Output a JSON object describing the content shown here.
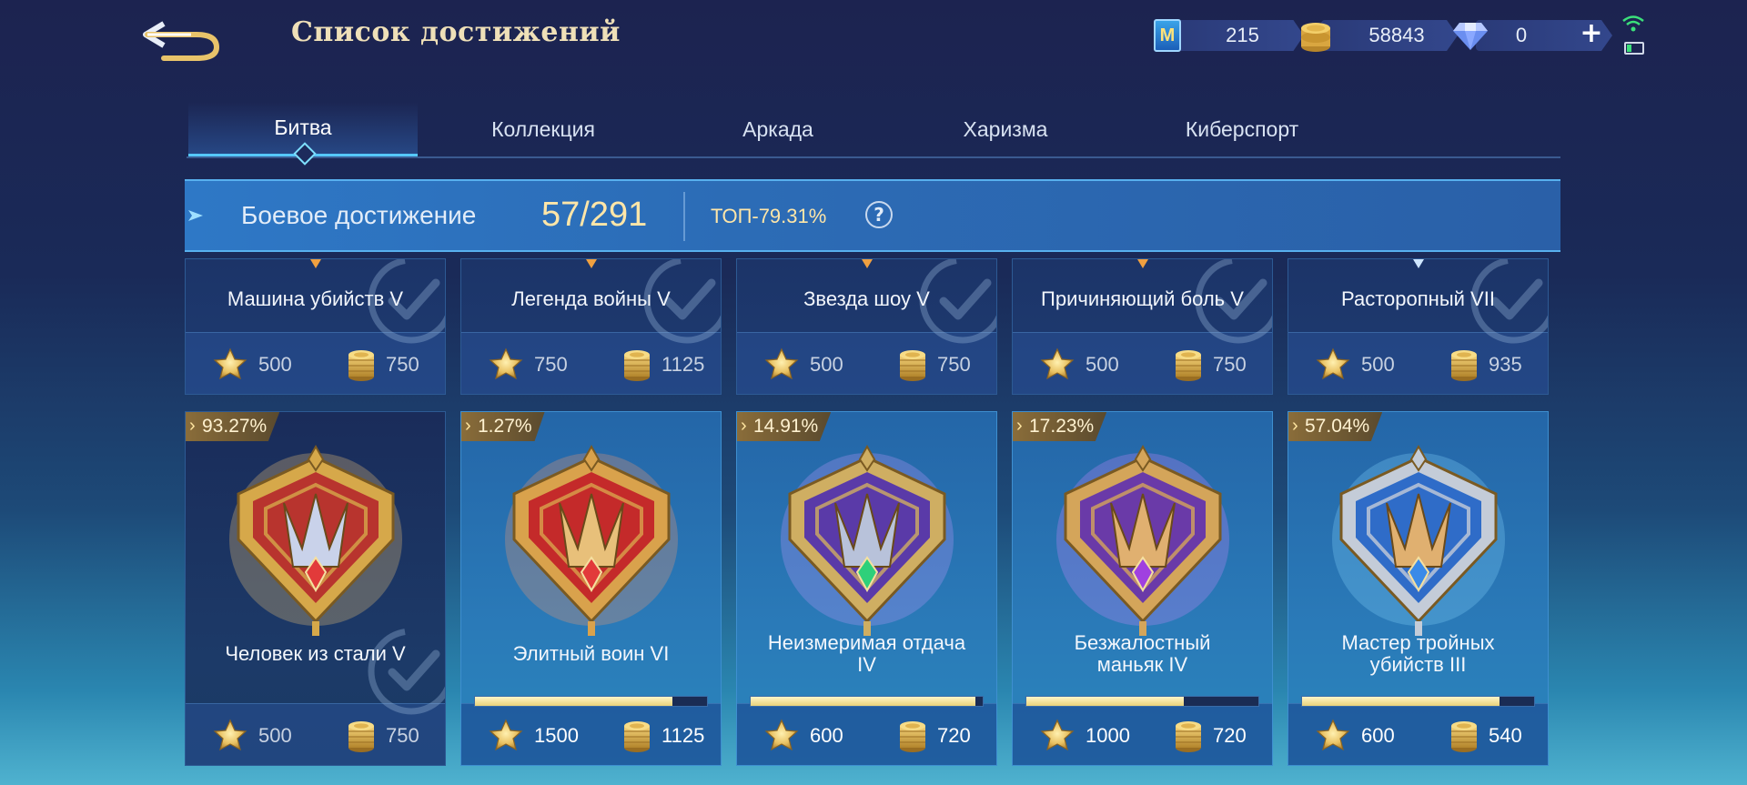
{
  "header": {
    "title": "Список достижений",
    "currencies": {
      "tickets": "215",
      "gold": "58843",
      "diamonds": "0"
    }
  },
  "tabs": [
    {
      "label": "Битва",
      "active": true
    },
    {
      "label": "Коллекция",
      "active": false
    },
    {
      "label": "Аркада",
      "active": false
    },
    {
      "label": "Харизма",
      "active": false
    },
    {
      "label": "Киберспорт",
      "active": false
    }
  ],
  "summary": {
    "label": "Боевое достижение",
    "count": "57/291",
    "top": "ТОП-79.31%"
  },
  "top_cards": [
    {
      "name": "Машина убийств  V",
      "stars": "500",
      "coins": "750",
      "pin_color": "#f0a040"
    },
    {
      "name": "Легенда войны  V",
      "stars": "750",
      "coins": "1125",
      "pin_color": "#f0a040"
    },
    {
      "name": "Звезда шоу  V",
      "stars": "500",
      "coins": "750",
      "pin_color": "#f0a040"
    },
    {
      "name": "Причиняющий боль V",
      "stars": "500",
      "coins": "750",
      "pin_color": "#f0a040"
    },
    {
      "name": "Расторопный VII",
      "stars": "500",
      "coins": "935",
      "pin_color": "#cfe6ff"
    }
  ],
  "big_cards": [
    {
      "name": "Человек из стали  V",
      "percent": "93.27%",
      "stars": "500",
      "coins": "750",
      "completed": true,
      "progress": null,
      "theme": "gold"
    },
    {
      "name": "Элитный воин VI",
      "percent": "1.27%",
      "stars": "1500",
      "coins": "1125",
      "completed": false,
      "progress": 0.85,
      "theme": "red"
    },
    {
      "name": "Неизмеримая отдача IV",
      "percent": "14.91%",
      "stars": "600",
      "coins": "720",
      "completed": false,
      "progress": 0.97,
      "theme": "purple"
    },
    {
      "name": "Безжалостный маньяк IV",
      "percent": "17.23%",
      "stars": "1000",
      "coins": "720",
      "completed": false,
      "progress": 0.68,
      "theme": "violet"
    },
    {
      "name": "Мастер тройных убийств III",
      "percent": "57.04%",
      "stars": "600",
      "coins": "540",
      "completed": false,
      "progress": 0.85,
      "theme": "blue"
    }
  ],
  "colors": {
    "gold": "#e8c36a",
    "accent": "#55c8ff",
    "progress_fill": "#f0dc8a",
    "percent_text": "#fff2d0"
  },
  "icons": [
    "back-arrow-icon",
    "ticket-icon",
    "gold-coin-icon",
    "diamond-icon",
    "plus-icon",
    "wifi-icon",
    "battery-icon",
    "help-icon",
    "star-icon",
    "coin-stack-icon",
    "checkmark-icon",
    "achievement-badge-icon"
  ]
}
